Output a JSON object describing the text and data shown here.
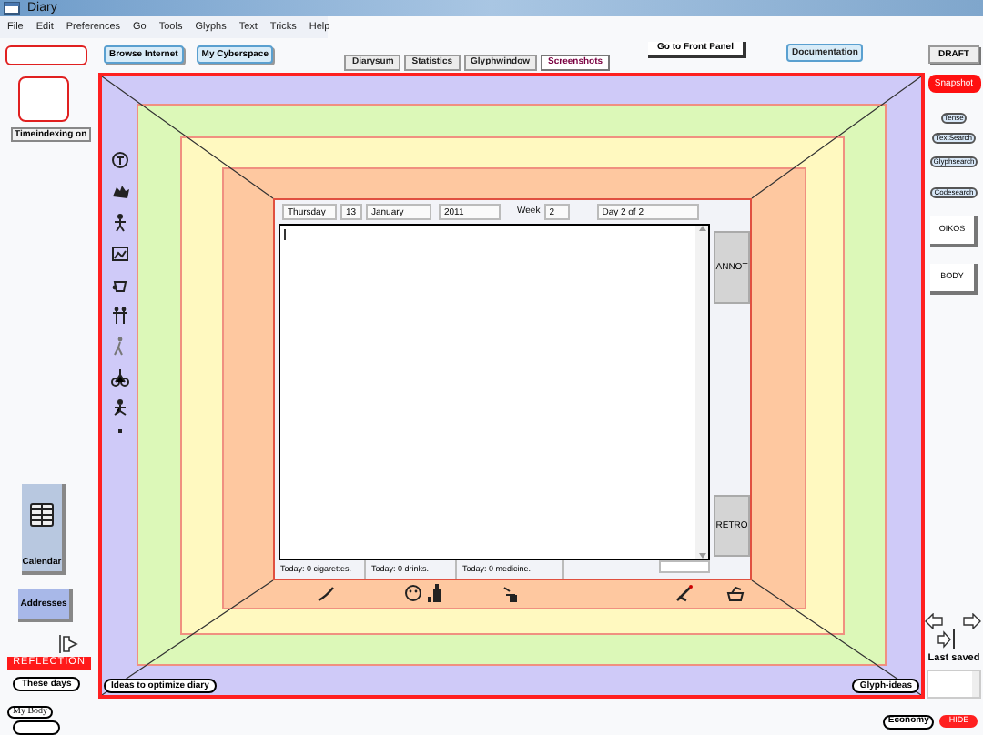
{
  "window": {
    "title": "Diary"
  },
  "menu": [
    "File",
    "Edit",
    "Preferences",
    "Go",
    "Tools",
    "Glyphs",
    "Text",
    "Tricks",
    "Help"
  ],
  "toolbar": {
    "browse": "Browse Internet",
    "cyberspace": "My Cyberspace",
    "front_panel": "Go to Front Panel",
    "documentation": "Documentation",
    "draft": "DRAFT"
  },
  "tabs": [
    {
      "label": "Diarysum",
      "selected": false
    },
    {
      "label": "Statistics",
      "selected": false
    },
    {
      "label": "Glyphwindow",
      "selected": false
    },
    {
      "label": "Screenshots",
      "selected": true
    }
  ],
  "left_panel": {
    "timeindexing": "Timeindexing on",
    "calendar": "Calendar",
    "addresses": "Addresses",
    "reflection": "REFLECTION",
    "links": [
      "These days",
      "My Body"
    ]
  },
  "entry": {
    "weekday": "Thursday",
    "day": "13",
    "month": "January",
    "year": "2011",
    "week_label": "Week",
    "week": "2",
    "day_of": "Day 2 of 2",
    "annot": "ANNOT",
    "retro": "RETRO",
    "counters": [
      "Today: 0 cigarettes.",
      "Today: 0 drinks.",
      "Today: 0 medicine."
    ]
  },
  "frame": {
    "ideas": "Ideas to optimize diary",
    "glyph_ideas": "Glyph-ideas"
  },
  "right_panel": {
    "snapshot": "Snapshot",
    "searches": [
      "Tense",
      "TextSearch",
      "Glyphsearch",
      "Codesearch"
    ],
    "oikos": "OIKOS",
    "body": "BODY",
    "last_saved": "Last saved",
    "economy": "Economy",
    "hide": "HIDE"
  }
}
